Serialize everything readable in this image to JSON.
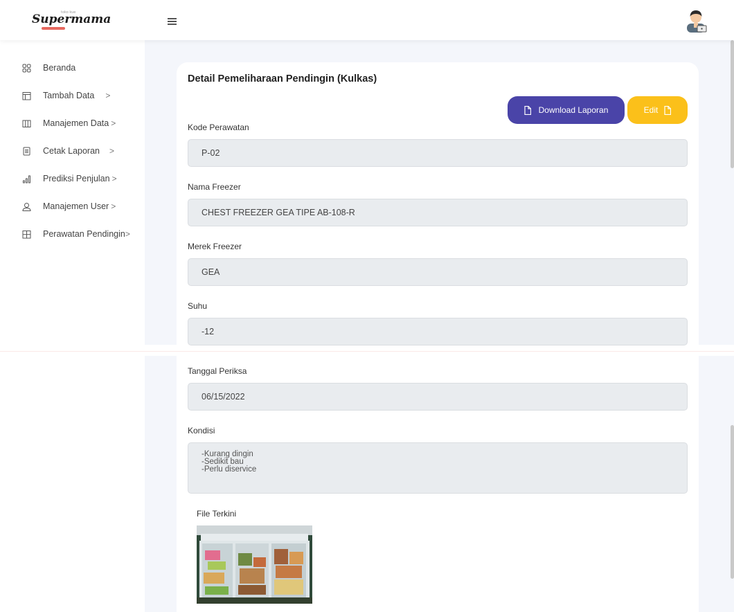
{
  "app": {
    "logo_text": "Supermama",
    "logo_small_text": "toko kue"
  },
  "sidebar": {
    "items": [
      {
        "label": "Beranda",
        "icon": "grid-icon",
        "chevron": ""
      },
      {
        "label": "Tambah Data",
        "icon": "table-icon",
        "chevron": ">"
      },
      {
        "label": "Manajemen Data",
        "icon": "columns-icon",
        "chevron": ">"
      },
      {
        "label": "Cetak Laporan",
        "icon": "document-icon",
        "chevron": ">"
      },
      {
        "label": "Prediksi Penjulan",
        "icon": "bar-chart-icon",
        "chevron": ">"
      },
      {
        "label": "Manajemen User",
        "icon": "user-icon",
        "chevron": ">"
      },
      {
        "label": "Perawatan Pendingin",
        "icon": "box-grid-icon",
        "chevron": ">"
      }
    ]
  },
  "page": {
    "title": "Detail Pemeliharaan Pendingin (Kulkas)",
    "download_label": "Download Laporan",
    "edit_label": "Edit"
  },
  "fields": {
    "kode": {
      "label": "Kode Perawatan",
      "value": "P-02"
    },
    "nama": {
      "label": "Nama Freezer",
      "value": "CHEST FREEZER GEA TIPE AB-108-R"
    },
    "merek": {
      "label": "Merek Freezer",
      "value": "GEA"
    },
    "suhu": {
      "label": "Suhu",
      "value": "-12"
    },
    "tanggal": {
      "label": "Tanggal Periksa",
      "value": "06/15/2022"
    },
    "kondisi": {
      "label": "Kondisi",
      "lines": [
        "-Kurang dingin",
        "-Sedikit bau",
        "-Perlu diservice"
      ]
    },
    "file": {
      "label": "File Terkini"
    }
  },
  "colors": {
    "primary": "#4a44a8",
    "warning": "#fbc01a",
    "background": "#f4f6fb",
    "input_bg": "#e9ecef"
  }
}
